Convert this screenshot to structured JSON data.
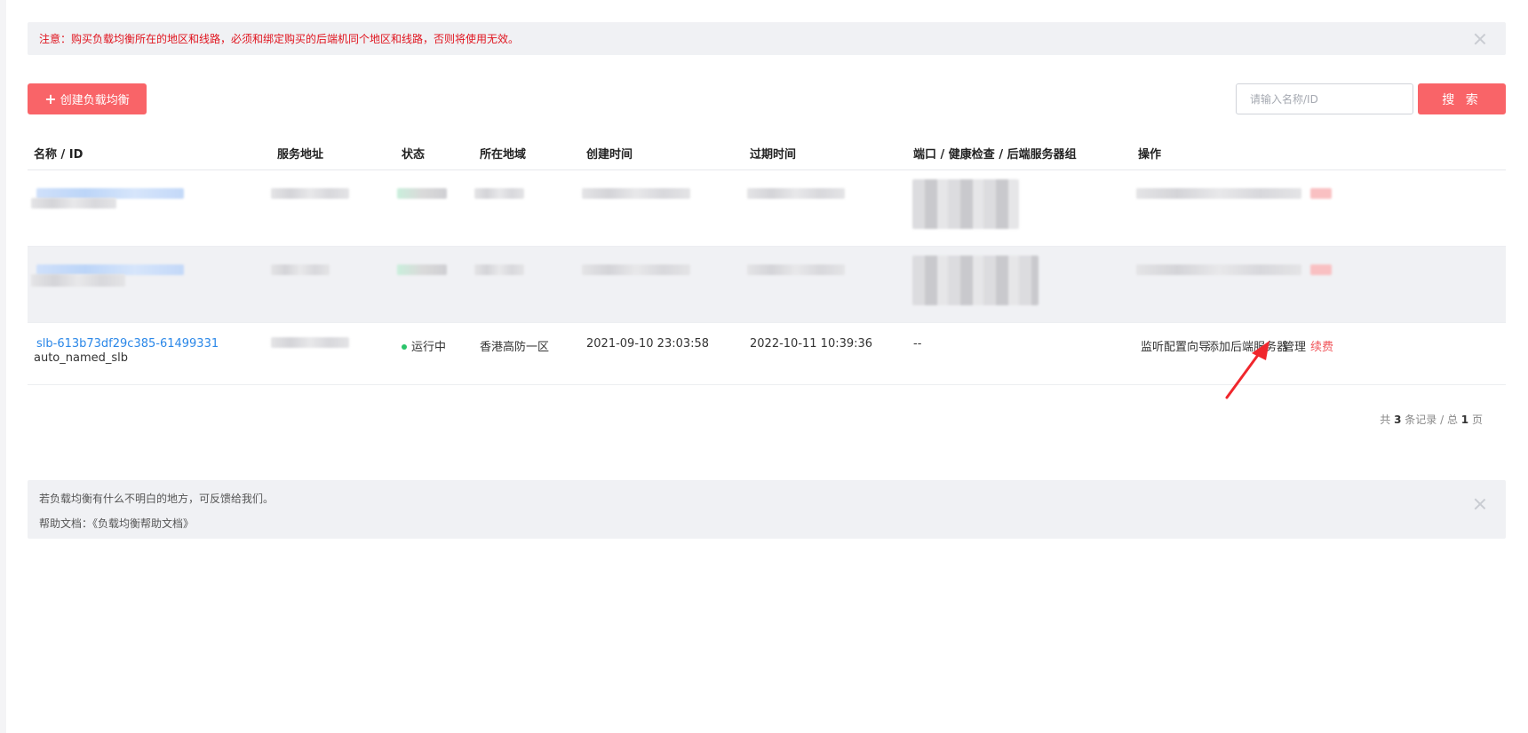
{
  "notice": {
    "text": "注意：购买负载均衡所在的地区和线路，必须和绑定购买的后端机同个地区和线路，否则将使用无效。"
  },
  "toolbar": {
    "create_label": "创建负载均衡",
    "search_placeholder": "请输入名称/ID",
    "search_label": "搜 索"
  },
  "table": {
    "headers": {
      "name_id": "名称 / ID",
      "address": "服务地址",
      "status": "状态",
      "region": "所在地域",
      "created": "创建时间",
      "expires": "过期时间",
      "ports": "端口 / 健康检查 / 后端服务器组",
      "actions": "操作"
    },
    "row3": {
      "id": "slb-613b73df29c385-61499331",
      "name": "auto_named_slb",
      "status": "运行中",
      "region": "香港高防一区",
      "created": "2021-09-10 23:03:58",
      "expires": "2022-10-11 10:39:36",
      "ports": "--",
      "actions": {
        "listen_wizard": "监听配置向导",
        "add_backend": "添加后端服务器",
        "manage": "管理",
        "renew": "续费"
      }
    }
  },
  "pager": {
    "prefix": "共",
    "total": "3",
    "middle": "条记录 / 总",
    "pages": "1",
    "suffix": "页"
  },
  "help": {
    "line1": "若负载均衡有什么不明白的地方，可反馈给我们。",
    "line2": "帮助文档：《负载均衡帮助文档》"
  },
  "colors": {
    "accent": "#f96468",
    "link": "#2a87e8",
    "notice_text": "#e0141e",
    "status_running": "#2bc46a"
  }
}
